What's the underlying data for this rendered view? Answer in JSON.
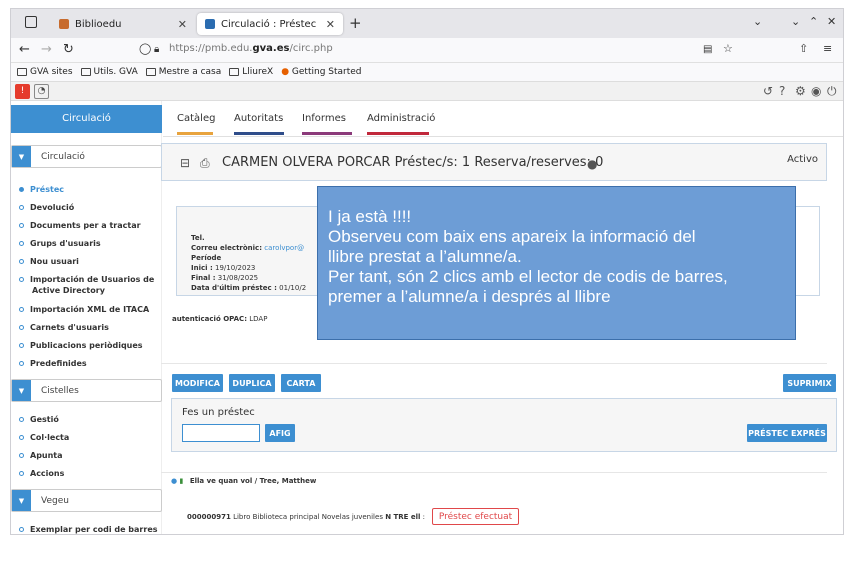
{
  "browser": {
    "tab1": {
      "title": "Biblioedu"
    },
    "tab2": {
      "title": "Circulació : Préstec"
    },
    "new_tab": "+",
    "url_prefix": "https://pmb.edu.",
    "url_domain": "gva.es",
    "url_path": "/circ.php",
    "bookmarks": [
      "GVA sites",
      "Utils. GVA",
      "Mestre a casa",
      "LliureX",
      "Getting Started"
    ]
  },
  "sidebar": {
    "title": "Circulació",
    "sections": [
      {
        "label": "Circulació",
        "items": [
          "Préstec",
          "Devolució",
          "Documents per a tractar",
          "Grups d'usuaris",
          "Nou usuari",
          "Importación de Usuarios de",
          "Active Directory",
          "Importación XML de ITACA",
          "Carnets d'usuaris",
          "Publicacions periòdiques",
          "Predefinides"
        ]
      },
      {
        "label": "Cistelles",
        "items": [
          "Gestió",
          "Col·lecta",
          "Apunta",
          "Accions"
        ]
      },
      {
        "label": "Vegeu",
        "items": [
          "Exemplar per codi de barres"
        ]
      }
    ],
    "active_item": "Préstec"
  },
  "main_tabs": [
    {
      "label": "Catàleg",
      "color": "#e8a33d"
    },
    {
      "label": "Autoritats",
      "color": "#2f4d8a"
    },
    {
      "label": "Informes",
      "color": "#8b3a7a"
    },
    {
      "label": "Administració",
      "color": "#c0283b"
    }
  ],
  "user": {
    "name_line": "CARMEN OLVERA PORCAR  Préstec/s: 1  Reserva/reserves: 0",
    "status": "Activo",
    "tel_label": "Tel.",
    "email_label": "Correu electrònic:",
    "email_value": "carolvpor@",
    "periode_label": "Període",
    "inici_label": "Inici :",
    "inici_value": "19/10/2023",
    "final_label": "Final :",
    "final_value": "31/08/2025",
    "last_loan_label": "Data d'últim préstec :",
    "last_loan_value": "01/10/2",
    "opac_label": "autenticació OPAC:",
    "opac_value": "LDAP"
  },
  "buttons": {
    "modify": "MODIFICA",
    "duplicate": "DUPLICA",
    "card": "CARTA",
    "delete": "SUPRIMIX",
    "add": "AFIG",
    "express": "PRÉSTEC EXPRÉS"
  },
  "loan": {
    "label": "Fes un préstec",
    "input_value": ""
  },
  "book": {
    "title": "Ella ve quan vol / Tree, Matthew"
  },
  "copy": {
    "barcode": "000000971",
    "desc": "Libro Biblioteca principal Novelas juveniles",
    "cote": "N TRE ell",
    "status": "Préstec efectuat"
  },
  "note": {
    "lines": [
      "I ja està !!!!",
      "Observeu com baix ens apareix la informació del",
      "llibre prestat a l’alumne/a.",
      "Per tant, són 2 clics amb el lector de codis de barres,",
      "premer a l’alumne/a i després al llibre"
    ]
  }
}
